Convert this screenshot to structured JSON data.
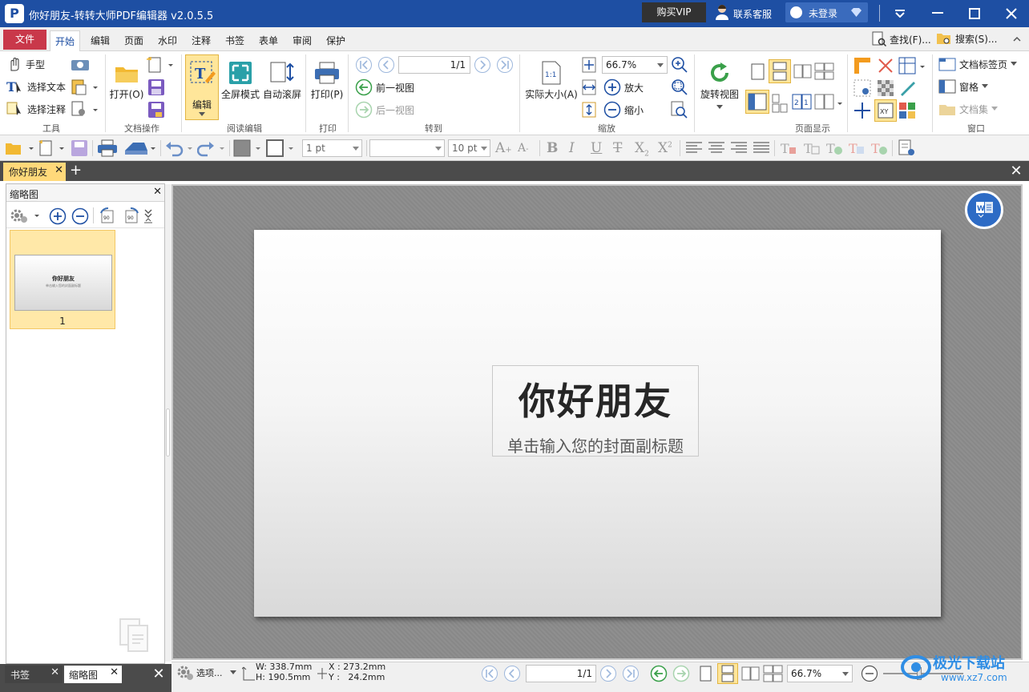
{
  "window": {
    "title": "你好朋友-转转大师PDF编辑器 v2.0.5.5",
    "vip": "购买VIP",
    "support": "联系客服",
    "login": "未登录"
  },
  "menu": {
    "file": "文件",
    "tabs": [
      "开始",
      "编辑",
      "页面",
      "水印",
      "注释",
      "书签",
      "表单",
      "审阅",
      "保护"
    ],
    "find": "查找(F)...",
    "search": "搜索(S)..."
  },
  "ribbon": {
    "tools": {
      "hand": "手型",
      "select_text": "选择文本",
      "select_annot": "选择注释",
      "label": "工具"
    },
    "docops": {
      "open": "打开(O)",
      "label": "文档操作"
    },
    "reading": {
      "edit": "编辑",
      "fullscreen": "全屏模式",
      "autoscroll": "自动滚屏",
      "label": "阅读编辑"
    },
    "print": {
      "print": "打印(P)",
      "label": "打印"
    },
    "goto": {
      "page_value": "1/1",
      "prev_view": "前一视图",
      "next_view": "后一视图",
      "label": "转到"
    },
    "zoom": {
      "actual": "实际大小(A)",
      "zoom_value": "66.7%",
      "zoom_in": "放大",
      "zoom_out": "缩小",
      "label": "缩放"
    },
    "display": {
      "rotate": "旋转视图",
      "label": "页面显示"
    },
    "window": {
      "tabs": "文档标签页",
      "panes": "窗格",
      "docset": "文档集",
      "label": "窗口"
    }
  },
  "quickbar": {
    "line_width": "1 pt",
    "font_size": "10 pt",
    "font_name": ""
  },
  "doc_tab": {
    "name": "你好朋友"
  },
  "sidebar": {
    "title": "缩略图",
    "page_num": "1",
    "thumb_title": "你好朋友",
    "thumb_subtitle": "单击输入您的封面副标题",
    "tab_bookmark": "书签",
    "tab_thumbs": "缩略图"
  },
  "document": {
    "title": "你好朋友",
    "subtitle": "单击输入您的封面副标题"
  },
  "status": {
    "options": "选项...",
    "width": "W: 338.7mm",
    "height": "H: 190.5mm",
    "x": "X : 273.2mm",
    "y": "Y :   24.2mm",
    "page": "1/1",
    "zoom": "66.7%"
  },
  "watermark": {
    "text": "极光下载站",
    "url": "www.xz7.com"
  },
  "colors": {
    "title_bar": "#1e4fa3",
    "file_tab": "#c9384a",
    "vip_bg": "#323232",
    "active_thumb": "#ffe8a8",
    "tab_active": "#ffd97a"
  }
}
